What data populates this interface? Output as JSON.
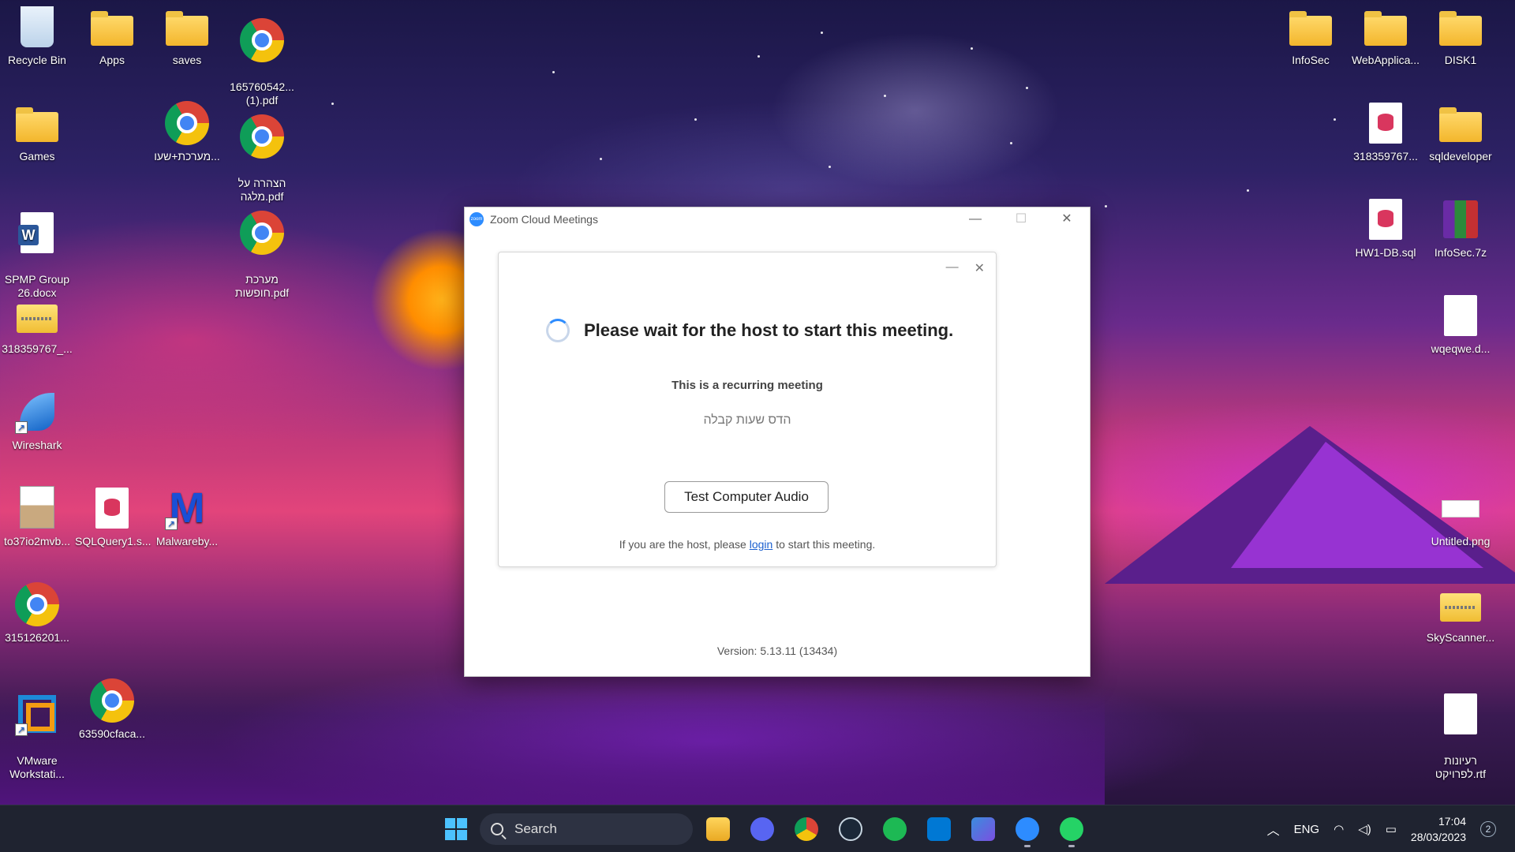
{
  "desktop": {
    "left_icons": [
      {
        "label": "Recycle Bin",
        "icon": "recycle-bin-icon"
      },
      {
        "label": "Apps",
        "icon": "folder-icon"
      },
      {
        "label": "saves",
        "icon": "folder-icon"
      },
      {
        "label": "165760542...\n(1).pdf",
        "icon": "chrome-icon"
      },
      {
        "label": "Games",
        "icon": "folder-icon"
      },
      {
        "label": "מערכת+שעו...",
        "icon": "chrome-icon"
      },
      {
        "label": "הצהרה על\nמלגה.pdf",
        "icon": "chrome-icon"
      },
      {
        "label": "SPMP Group\n26.docx",
        "icon": "word-icon"
      },
      {
        "label": "מערכת\nחופשות.pdf",
        "icon": "chrome-icon"
      },
      {
        "label": "318359767_...",
        "icon": "zip-folder-icon"
      },
      {
        "label": "Wireshark",
        "icon": "wireshark-icon"
      },
      {
        "label": "to37io2mvb...",
        "icon": "image-file-icon"
      },
      {
        "label": "SQLQuery1.s...",
        "icon": "sql-file-icon"
      },
      {
        "label": "Malwareby...",
        "icon": "malwarebytes-icon"
      },
      {
        "label": "315126201...",
        "icon": "chrome-icon"
      },
      {
        "label": "VMware\nWorkstati...",
        "icon": "vmware-icon"
      },
      {
        "label": "63590cfaca...",
        "icon": "chrome-icon"
      }
    ],
    "right_icons": [
      {
        "label": "InfoSec",
        "icon": "folder-icon"
      },
      {
        "label": "WebApplica...",
        "icon": "folder-icon"
      },
      {
        "label": "DISK1",
        "icon": "folder-icon"
      },
      {
        "label": "318359767...",
        "icon": "sql-file-icon"
      },
      {
        "label": "sqldeveloper",
        "icon": "folder-icon"
      },
      {
        "label": "HW1-DB.sql",
        "icon": "sql-file-icon"
      },
      {
        "label": "InfoSec.7z",
        "icon": "archive-icon"
      },
      {
        "label": "wqeqwe.d...",
        "icon": "blank-file-icon"
      },
      {
        "label": "Untitled.png",
        "icon": "png-file-icon"
      },
      {
        "label": "SkyScanner...",
        "icon": "zip-folder-icon"
      },
      {
        "label": "רעיונות\nלפרויקט.rtf",
        "icon": "rtf-file-icon"
      }
    ]
  },
  "zoom": {
    "window_title": "Zoom Cloud Meetings",
    "logo_text": "zoom",
    "minimize": "—",
    "maximize": "☐",
    "close": "✕",
    "card_minimize": "—",
    "card_close": "✕",
    "wait_message": "Please wait for the host to start this meeting.",
    "recurring": "This is a recurring meeting",
    "meeting_name": "הדס שעות קבלה",
    "test_audio_button": "Test Computer Audio",
    "host_prefix": "If you are the host, please ",
    "host_link": "login",
    "host_suffix": " to start this meeting.",
    "version": "Version: 5.13.11 (13434)"
  },
  "taskbar": {
    "search_label": "Search",
    "language": "ENG",
    "time": "17:04",
    "date": "28/03/2023",
    "notifications": "2",
    "apps": [
      "file-explorer",
      "discord",
      "chrome",
      "steam",
      "spotify",
      "vscode",
      "copilot",
      "zoom",
      "whatsapp"
    ]
  }
}
